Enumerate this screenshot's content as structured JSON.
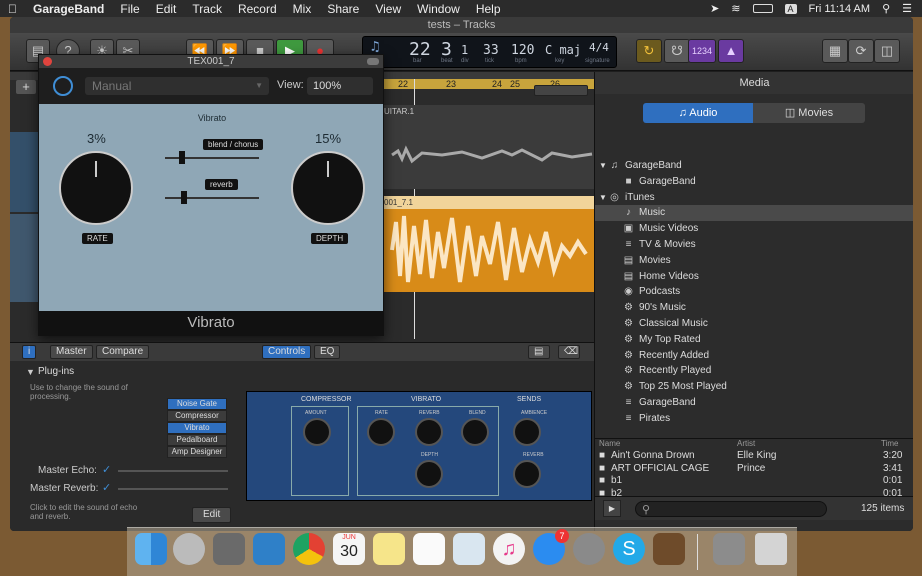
{
  "menubar": {
    "app": "GarageBand",
    "items": [
      "File",
      "Edit",
      "Track",
      "Record",
      "Mix",
      "Share",
      "View",
      "Window",
      "Help"
    ],
    "clock": "Fri 11:14 AM",
    "input_letter": "A"
  },
  "window": {
    "title": "tests – Tracks"
  },
  "lcd": {
    "bar": "22",
    "beat": "3",
    "div": "1",
    "tick": "33",
    "bpm": "120",
    "key": "C maj",
    "sig": "4/4",
    "bar_label": "bar",
    "beat_label": "beat",
    "div_label": "div",
    "tick_label": "tick",
    "bpm_label": "bpm",
    "key_label": "key",
    "sig_label": "signature",
    "count_in": "1234"
  },
  "ruler": {
    "marks": [
      "22",
      "23",
      "24",
      "25",
      "26"
    ]
  },
  "tracks": {
    "track1_label": "UITAR.1",
    "track2_label": "001_7.1"
  },
  "plugin": {
    "title": "TEX001_7",
    "preset": "Manual",
    "view_label": "View:",
    "view_value": "100%",
    "effect_name": "Vibrato",
    "rate_value": "3%",
    "rate_label": "RATE",
    "depth_value": "15%",
    "depth_label": "DEPTH",
    "blend_label": "blend / chorus",
    "reverb_label": "reverb",
    "footer": "Vibrato"
  },
  "editor": {
    "master": "Master",
    "compare": "Compare",
    "controls": "Controls",
    "eq": "EQ",
    "plugins_header": "Plug-ins",
    "plugins_help": "Use to change the sound of processing.",
    "slots": [
      "Noise Gate",
      "Compressor",
      "Vibrato",
      "Pedalboard",
      "Amp Designer"
    ],
    "master_echo": "Master Echo:",
    "master_reverb": "Master Reverb:",
    "edit_help": "Click to edit the sound of echo and reverb.",
    "edit_button": "Edit"
  },
  "rack": {
    "compressor": "COMPRESSOR",
    "vibrato": "VIBRATO",
    "sends": "SENDS",
    "amount": "AMOUNT",
    "rate": "RATE",
    "reverb": "REVERB",
    "blend": "BLEND",
    "depth": "DEPTH",
    "ambience": "AMBIENCE",
    "reverb2": "REVERB"
  },
  "media": {
    "title": "Media",
    "tab_audio": "Audio",
    "tab_movies": "Movies",
    "tree": [
      {
        "label": "GarageBand",
        "indent": 0,
        "icon": "guitar-icon"
      },
      {
        "label": "GarageBand",
        "indent": 1,
        "icon": "folder-icon"
      },
      {
        "label": "iTunes",
        "indent": 0,
        "icon": "itunes-icon"
      },
      {
        "label": "Music",
        "indent": 1,
        "icon": "music-note-icon",
        "selected": true
      },
      {
        "label": "Music Videos",
        "indent": 1,
        "icon": "video-icon"
      },
      {
        "label": "TV & Movies",
        "indent": 1,
        "icon": "list-icon"
      },
      {
        "label": "Movies",
        "indent": 1,
        "icon": "film-icon"
      },
      {
        "label": "Home Videos",
        "indent": 1,
        "icon": "film-icon"
      },
      {
        "label": "Podcasts",
        "indent": 1,
        "icon": "podcast-icon"
      },
      {
        "label": "90's Music",
        "indent": 1,
        "icon": "gear-icon"
      },
      {
        "label": "Classical Music",
        "indent": 1,
        "icon": "gear-icon"
      },
      {
        "label": "My Top Rated",
        "indent": 1,
        "icon": "gear-icon"
      },
      {
        "label": "Recently Added",
        "indent": 1,
        "icon": "gear-icon"
      },
      {
        "label": "Recently Played",
        "indent": 1,
        "icon": "gear-icon"
      },
      {
        "label": "Top 25 Most Played",
        "indent": 1,
        "icon": "gear-icon"
      },
      {
        "label": "GarageBand",
        "indent": 1,
        "icon": "list-icon"
      },
      {
        "label": "Pirates",
        "indent": 1,
        "icon": "list-icon"
      }
    ],
    "columns": [
      "Name",
      "Artist",
      "Time"
    ],
    "rows": [
      {
        "name": "Ain't Gonna Drown",
        "artist": "Elle King",
        "time": "3:20"
      },
      {
        "name": "ART OFFICIAL CAGE",
        "artist": "Prince",
        "time": "3:41"
      },
      {
        "name": "b1",
        "artist": "",
        "time": "0:01"
      },
      {
        "name": "b2",
        "artist": "",
        "time": "0:01"
      }
    ],
    "count": "125 items"
  },
  "dock": {
    "calendar_month": "JUN",
    "calendar_day": "30",
    "appstore_badge": "7",
    "icons": [
      "finder-icon",
      "launchpad-icon",
      "calculator-icon",
      "xcode-icon",
      "chrome-icon",
      "calendar-icon",
      "notes-icon",
      "reminders-icon",
      "preview-icon",
      "itunes-icon",
      "app-store-icon",
      "system-preferences-icon",
      "skype-icon",
      "garageband-icon",
      "finder-window-icon",
      "trash-icon"
    ]
  }
}
